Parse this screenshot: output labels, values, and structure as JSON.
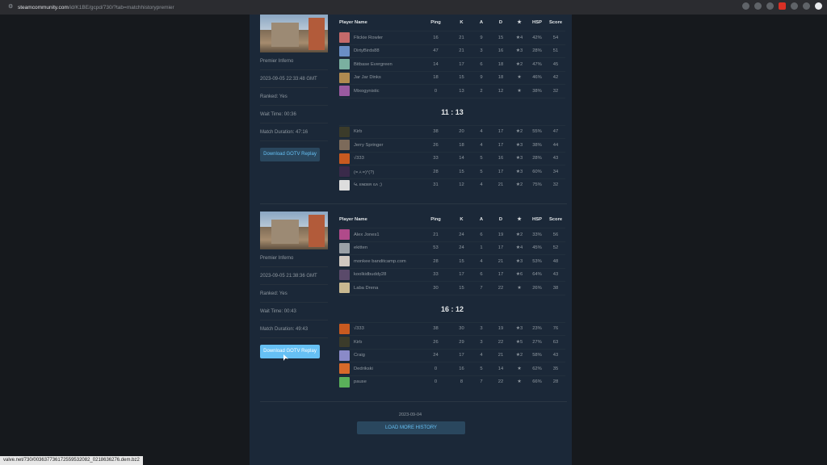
{
  "browser": {
    "url_host": "steamcommunity.com",
    "url_path": "/id/K1BE/gcpd/730/?tab=matchhistorypremier"
  },
  "headers": {
    "name": "Player Name",
    "ping": "Ping",
    "k": "K",
    "a": "A",
    "d": "D",
    "star": "★",
    "hsp": "HSP",
    "score": "Score"
  },
  "matches": [
    {
      "map": "Premier Inferno",
      "date": "2023-09-05 22:33:48 GMT",
      "ranked": "Ranked: Yes",
      "wait": "Wait Time: 00:36",
      "duration": "Match Duration: 47:16",
      "gotv": "Download GOTV Replay",
      "result": "11 : 13",
      "team1": [
        {
          "name": "Flickie Rowler",
          "ping": "16",
          "k": "21",
          "a": "9",
          "d": "15",
          "star": "★4",
          "hsp": "42%",
          "score": "54",
          "color": "#c46a6a"
        },
        {
          "name": "DirtyBirds88",
          "ping": "47",
          "k": "21",
          "a": "3",
          "d": "16",
          "star": "★3",
          "hsp": "28%",
          "score": "51",
          "color": "#6a8ec4"
        },
        {
          "name": "Bitbase Evergreen",
          "ping": "14",
          "k": "17",
          "a": "6",
          "d": "18",
          "star": "★2",
          "hsp": "47%",
          "score": "45",
          "color": "#7ab0a0"
        },
        {
          "name": "Jar Jar Dinks",
          "ping": "18",
          "k": "15",
          "a": "9",
          "d": "18",
          "star": "★",
          "hsp": "46%",
          "score": "42",
          "color": "#b08a50"
        },
        {
          "name": "Mixogynistic",
          "ping": "0",
          "k": "13",
          "a": "2",
          "d": "12",
          "star": "★",
          "hsp": "38%",
          "score": "32",
          "color": "#9a5aa0"
        }
      ],
      "team2": [
        {
          "name": "Kirb",
          "ping": "38",
          "k": "20",
          "a": "4",
          "d": "17",
          "star": "★2",
          "hsp": "55%",
          "score": "47",
          "color": "#3b3b2a"
        },
        {
          "name": "Jerry Springer",
          "ping": "26",
          "k": "18",
          "a": "4",
          "d": "17",
          "star": "★3",
          "hsp": "38%",
          "score": "44",
          "color": "#7c6a5a"
        },
        {
          "name": "√333",
          "ping": "33",
          "k": "14",
          "a": "5",
          "d": "16",
          "star": "★3",
          "hsp": "28%",
          "score": "43",
          "color": "#c85a20"
        },
        {
          "name": "(=ㅅ=)°(?)",
          "ping": "28",
          "k": "15",
          "a": "5",
          "d": "17",
          "star": "★3",
          "hsp": "60%",
          "score": "34",
          "color": "#3a2a4a"
        },
        {
          "name": "ϟʟ ᴇɴᴅᴇʀ ɢᴀ ;)",
          "ping": "31",
          "k": "12",
          "a": "4",
          "d": "21",
          "star": "★2",
          "hsp": "75%",
          "score": "32",
          "color": "#ddd"
        }
      ]
    },
    {
      "map": "Premier Inferno",
      "date": "2023-09-05 21:38:36 GMT",
      "ranked": "Ranked: Yes",
      "wait": "Wait Time: 00:43",
      "duration": "Match Duration: 49:43",
      "gotv": "Download GOTV Replay",
      "result": "16 : 12",
      "team1": [
        {
          "name": "Alex Jones1",
          "ping": "21",
          "k": "24",
          "a": "6",
          "d": "19",
          "star": "★2",
          "hsp": "33%",
          "score": "56",
          "color": "#b04a8a"
        },
        {
          "name": "ekitten",
          "ping": "53",
          "k": "24",
          "a": "1",
          "d": "17",
          "star": "★4",
          "hsp": "45%",
          "score": "52",
          "color": "#9aa0a6"
        },
        {
          "name": "monkee banditcamp.com",
          "ping": "28",
          "k": "15",
          "a": "4",
          "d": "21",
          "star": "★3",
          "hsp": "53%",
          "score": "48",
          "color": "#d0c8c0"
        },
        {
          "name": "koolkidbuddy28",
          "ping": "33",
          "k": "17",
          "a": "6",
          "d": "17",
          "star": "★6",
          "hsp": "64%",
          "score": "43",
          "color": "#5a4a6a"
        },
        {
          "name": "Laba Drena",
          "ping": "30",
          "k": "15",
          "a": "7",
          "d": "22",
          "star": "★",
          "hsp": "26%",
          "score": "38",
          "color": "#c8b890"
        }
      ],
      "team2": [
        {
          "name": "√333",
          "ping": "38",
          "k": "30",
          "a": "3",
          "d": "19",
          "star": "★3",
          "hsp": "23%",
          "score": "76",
          "color": "#c85a20"
        },
        {
          "name": "Kirb",
          "ping": "26",
          "k": "29",
          "a": "3",
          "d": "22",
          "star": "★5",
          "hsp": "27%",
          "score": "63",
          "color": "#3b3b2a"
        },
        {
          "name": "Craig",
          "ping": "24",
          "k": "17",
          "a": "4",
          "d": "21",
          "star": "★2",
          "hsp": "58%",
          "score": "43",
          "color": "#8a8ac8"
        },
        {
          "name": "Dedrikski",
          "ping": "0",
          "k": "16",
          "a": "5",
          "d": "14",
          "star": "★",
          "hsp": "62%",
          "score": "35",
          "color": "#d86a2a"
        },
        {
          "name": "pause",
          "ping": "0",
          "k": "8",
          "a": "7",
          "d": "22",
          "star": "★",
          "hsp": "66%",
          "score": "28",
          "color": "#5ab05a"
        }
      ]
    }
  ],
  "footer": {
    "date": "2023-09-04",
    "load_more": "LOAD MORE HISTORY"
  },
  "status_bar": "valve.net/730/003637736172559532082_0218636276.dem.bz2"
}
